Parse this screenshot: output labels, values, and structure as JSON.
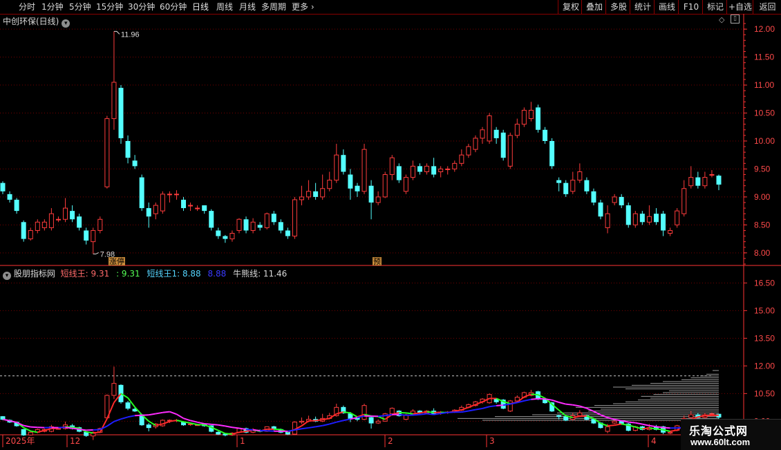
{
  "toolbar": {
    "periods": [
      "分时",
      "1分钟",
      "5分钟",
      "15分钟",
      "30分钟",
      "60分钟",
      "日线",
      "周线",
      "月线",
      "多周期",
      "更多"
    ],
    "active": "日线",
    "right": [
      "复权",
      "叠加",
      "多股",
      "统计",
      "画线",
      "F10",
      "标记",
      "+自选",
      "返回"
    ]
  },
  "main": {
    "title": "中创环保(日线)",
    "high_label": "11.96",
    "low_label": "7.98",
    "tag_zhangting": "涨停",
    "tag_yu": "预"
  },
  "indicator": {
    "name": "股朋指标网",
    "short_label": "短线王: 9.31",
    "short_colon": ": 9.31",
    "short1_label": "短线王1: 8.88",
    "short1_val": "8.88",
    "bear_label": "牛熊线: 11.46"
  },
  "colors": {
    "up": "#ff3c3c",
    "down": "#54ffff",
    "grid": "#7a0000",
    "axis": "#ff3333",
    "blue": "#1e1eff",
    "magenta": "#ff2bff",
    "green": "#22ff22",
    "red": "#ff2a2a"
  },
  "watermark": {
    "title": "乐淘公式网",
    "url": "www.60lt.com"
  },
  "xaxis": {
    "labels": [
      "2025年",
      "12",
      "1",
      "2",
      "3",
      "4"
    ]
  },
  "chart_data": [
    {
      "type": "candlestick",
      "title": "中创环保(日线)",
      "ylim": [
        7.8,
        12.15
      ],
      "yticks": [
        8.0,
        8.5,
        9.0,
        9.5,
        10.0,
        10.5,
        11.0,
        11.5,
        12.0
      ],
      "ytick_labels": [
        "8.00",
        "8.50",
        "9.00",
        "9.50",
        "10.00",
        "10.50",
        "11.00",
        "11.50",
        "12.00"
      ],
      "annotations": [
        {
          "text": "11.96",
          "value": 11.96
        },
        {
          "text": "7.98",
          "value": 7.98
        },
        {
          "text": "涨停"
        },
        {
          "text": "预"
        }
      ],
      "candles": [
        [
          9.25,
          9.1,
          9.28,
          9.05
        ],
        [
          9.05,
          8.95,
          9.1,
          8.9
        ],
        [
          8.95,
          8.75,
          8.98,
          8.7
        ],
        [
          8.55,
          8.25,
          8.58,
          8.2
        ],
        [
          8.25,
          8.4,
          8.45,
          8.22
        ],
        [
          8.4,
          8.55,
          8.6,
          8.35
        ],
        [
          8.45,
          8.55,
          8.6,
          8.4
        ],
        [
          8.45,
          8.7,
          8.8,
          8.4
        ],
        [
          8.6,
          8.6,
          8.65,
          8.55
        ],
        [
          8.6,
          8.8,
          8.98,
          8.55
        ],
        [
          8.75,
          8.6,
          8.85,
          8.55
        ],
        [
          8.65,
          8.45,
          8.7,
          8.4
        ],
        [
          8.4,
          8.22,
          8.45,
          8.15
        ],
        [
          8.2,
          8.4,
          8.45,
          7.98
        ],
        [
          8.4,
          8.6,
          8.65,
          8.35
        ],
        [
          9.18,
          10.4,
          10.45,
          9.15
        ],
        [
          10.4,
          11.05,
          11.96,
          10.2
        ],
        [
          10.95,
          10.05,
          11.0,
          9.95
        ],
        [
          10.0,
          9.7,
          10.1,
          9.6
        ],
        [
          9.65,
          9.55,
          9.75,
          9.5
        ],
        [
          9.35,
          8.8,
          9.4,
          8.75
        ],
        [
          8.8,
          8.65,
          8.9,
          8.45
        ],
        [
          8.7,
          8.85,
          8.9,
          8.6
        ],
        [
          8.75,
          9.05,
          9.1,
          8.7
        ],
        [
          9.05,
          9.05,
          9.1,
          8.9
        ],
        [
          9.05,
          9.05,
          9.12,
          8.95
        ],
        [
          8.95,
          8.8,
          9.0,
          8.75
        ],
        [
          8.85,
          8.85,
          8.9,
          8.75
        ],
        [
          8.8,
          8.8,
          8.85,
          8.75
        ],
        [
          8.85,
          8.75,
          8.85,
          8.7
        ],
        [
          8.75,
          8.45,
          8.78,
          8.4
        ],
        [
          8.4,
          8.3,
          8.45,
          8.25
        ],
        [
          8.3,
          8.25,
          8.32,
          8.18
        ],
        [
          8.25,
          8.35,
          8.4,
          8.2
        ],
        [
          8.4,
          8.6,
          8.62,
          8.35
        ],
        [
          8.6,
          8.4,
          8.65,
          8.35
        ],
        [
          8.4,
          8.55,
          8.62,
          8.35
        ],
        [
          8.5,
          8.45,
          8.55,
          8.4
        ],
        [
          8.45,
          8.7,
          8.72,
          8.42
        ],
        [
          8.7,
          8.55,
          8.75,
          8.5
        ],
        [
          8.55,
          8.4,
          8.6,
          8.35
        ],
        [
          8.4,
          8.3,
          8.45,
          8.25
        ],
        [
          8.3,
          8.95,
          9.0,
          8.25
        ],
        [
          8.95,
          9.0,
          9.2,
          8.85
        ],
        [
          9.0,
          9.1,
          9.3,
          8.95
        ],
        [
          9.1,
          9.0,
          9.25,
          8.95
        ],
        [
          9.0,
          9.15,
          9.4,
          8.95
        ],
        [
          9.15,
          9.3,
          9.45,
          9.1
        ],
        [
          9.3,
          9.75,
          9.95,
          9.25
        ],
        [
          9.75,
          9.45,
          9.85,
          9.4
        ],
        [
          9.4,
          9.15,
          9.5,
          8.95
        ],
        [
          9.2,
          9.1,
          9.25,
          9.0
        ],
        [
          9.1,
          9.85,
          9.95,
          9.05
        ],
        [
          9.2,
          8.9,
          9.3,
          8.6
        ],
        [
          8.9,
          9.0,
          9.1,
          8.85
        ],
        [
          9.0,
          9.4,
          9.45,
          8.98
        ],
        [
          9.4,
          9.7,
          9.75,
          9.3
        ],
        [
          9.55,
          9.3,
          9.6,
          9.25
        ],
        [
          9.1,
          9.35,
          9.4,
          9.05
        ],
        [
          9.35,
          9.55,
          9.65,
          9.3
        ],
        [
          9.55,
          9.45,
          9.6,
          9.4
        ],
        [
          9.45,
          9.55,
          9.6,
          9.4
        ],
        [
          9.55,
          9.4,
          9.7,
          9.35
        ],
        [
          9.45,
          9.5,
          9.55,
          9.35
        ],
        [
          9.5,
          9.5,
          9.55,
          9.4
        ],
        [
          9.5,
          9.6,
          9.65,
          9.45
        ],
        [
          9.6,
          9.75,
          9.85,
          9.55
        ],
        [
          9.75,
          9.9,
          9.95,
          9.7
        ],
        [
          9.85,
          10.05,
          10.1,
          9.8
        ],
        [
          10.05,
          10.2,
          10.25,
          9.95
        ],
        [
          10.0,
          10.45,
          10.5,
          9.95
        ],
        [
          10.2,
          10.05,
          10.25,
          9.95
        ],
        [
          10.15,
          9.7,
          10.2,
          9.65
        ],
        [
          9.55,
          10.1,
          10.15,
          9.5
        ],
        [
          10.1,
          10.3,
          10.4,
          10.05
        ],
        [
          10.3,
          10.55,
          10.6,
          10.25
        ],
        [
          10.4,
          10.55,
          10.7,
          10.35
        ],
        [
          10.6,
          10.2,
          10.65,
          10.15
        ],
        [
          10.2,
          10.0,
          10.25,
          9.95
        ],
        [
          10.0,
          9.55,
          10.05,
          9.5
        ],
        [
          9.3,
          9.25,
          9.35,
          9.1
        ],
        [
          9.25,
          9.05,
          9.3,
          9.0
        ],
        [
          9.1,
          9.3,
          9.45,
          9.05
        ],
        [
          9.3,
          9.45,
          9.6,
          9.25
        ],
        [
          9.3,
          9.1,
          9.35,
          9.05
        ],
        [
          9.1,
          8.9,
          9.15,
          8.85
        ],
        [
          8.9,
          8.65,
          8.95,
          8.6
        ],
        [
          8.45,
          8.7,
          8.85,
          8.35
        ],
        [
          8.9,
          9.0,
          9.05,
          8.85
        ],
        [
          9.0,
          8.85,
          9.05,
          8.8
        ],
        [
          8.85,
          8.5,
          8.9,
          8.45
        ],
        [
          8.5,
          8.7,
          8.75,
          8.45
        ],
        [
          8.7,
          8.55,
          8.75,
          8.5
        ],
        [
          8.55,
          8.65,
          8.85,
          8.5
        ],
        [
          8.7,
          8.55,
          8.8,
          8.5
        ],
        [
          8.7,
          8.4,
          8.75,
          8.3
        ],
        [
          8.35,
          8.4,
          8.45,
          8.3
        ],
        [
          8.5,
          8.75,
          8.8,
          8.45
        ],
        [
          8.7,
          9.15,
          9.3,
          8.65
        ],
        [
          9.2,
          9.35,
          9.55,
          9.15
        ],
        [
          9.35,
          9.2,
          9.45,
          9.15
        ],
        [
          9.2,
          9.35,
          9.45,
          9.15
        ],
        [
          9.4,
          9.4,
          9.48,
          9.35
        ],
        [
          9.38,
          9.22,
          9.4,
          9.12
        ]
      ]
    },
    {
      "type": "line",
      "title": "股朋指标网",
      "ylim": [
        8.3,
        17.3
      ],
      "yticks": [
        9.0,
        10.5,
        12.0,
        13.5,
        15.0,
        16.5
      ],
      "ytick_labels": [
        "9.00",
        "10.50",
        "12.00",
        "13.50",
        "15.00",
        "16.50"
      ],
      "series": [
        {
          "name": "短线王",
          "value": 9.31
        },
        {
          "name": "短线王1",
          "value": 8.88
        },
        {
          "name": "牛熊线",
          "value": 11.46
        }
      ]
    }
  ]
}
